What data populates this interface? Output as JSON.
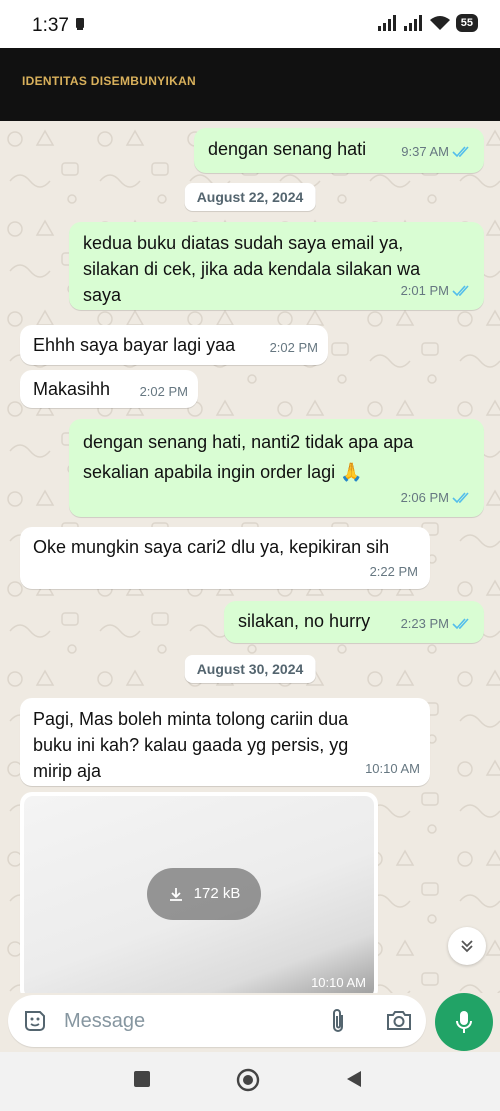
{
  "status_bar": {
    "time": "1:37",
    "battery": "55"
  },
  "header": {
    "title": "IDENTITAS DISEMBUNYIKAN"
  },
  "messages": [
    {
      "direction": "out",
      "text": "dengan senang hati",
      "time": "9:37 AM",
      "status": "read"
    },
    {
      "type": "date",
      "label": "August 22, 2024"
    },
    {
      "direction": "out",
      "lines": [
        "kedua buku diatas sudah saya email ya,",
        "silakan di cek, jika ada kendala silakan wa",
        "saya"
      ],
      "time": "2:01 PM",
      "status": "read"
    },
    {
      "direction": "in",
      "text": "Ehhh saya bayar lagi yaa",
      "time": "2:02 PM"
    },
    {
      "direction": "in",
      "text": "Makasihh",
      "time": "2:02 PM"
    },
    {
      "direction": "out",
      "lines": [
        "dengan senang hati, nanti2 tidak apa apa",
        "sekalian apabila ingin order lagi 🙏"
      ],
      "time": "2:06 PM",
      "status": "read"
    },
    {
      "direction": "in",
      "text": "Oke mungkin saya cari2 dlu ya, kepikiran sih",
      "time": "2:22 PM"
    },
    {
      "direction": "out",
      "text": "silakan, no hurry",
      "time": "2:23 PM",
      "status": "read"
    },
    {
      "type": "date",
      "label": "August 30, 2024"
    },
    {
      "direction": "in",
      "lines": [
        "Pagi, Mas boleh minta tolong cariin dua",
        "buku ini kah? kalau gaada yg persis, yg",
        "mirip aja"
      ],
      "time": "10:10 AM"
    },
    {
      "direction": "in",
      "type": "image",
      "download_size": "172 kB",
      "time": "10:10 AM"
    }
  ],
  "composer": {
    "placeholder": "Message"
  },
  "icons": {
    "sticker": "sticker-icon",
    "attach": "paperclip-icon",
    "camera": "camera-icon",
    "mic": "microphone-icon",
    "scroll": "double-chevron-down-icon",
    "download": "download-icon"
  },
  "colors": {
    "outgoing_bubble": "#d9fdd3",
    "incoming_bubble": "#ffffff",
    "chat_background": "#efeae2",
    "read_ticks": "#53bdeb",
    "header_background": "#111111",
    "header_text": "#d9b15c",
    "mic_button": "#21a366"
  }
}
